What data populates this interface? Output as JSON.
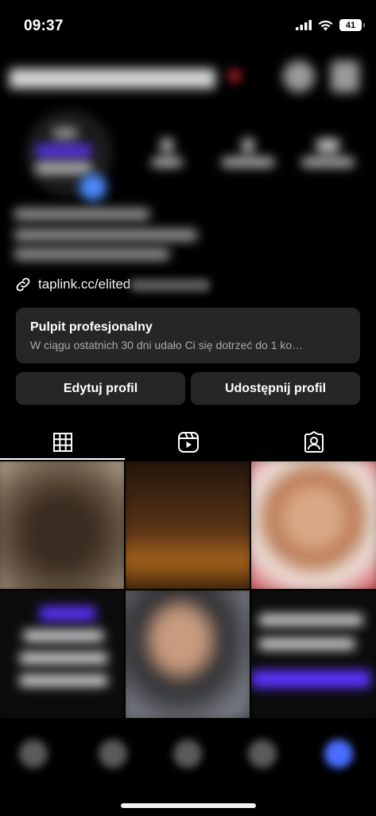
{
  "status_bar": {
    "time": "09:37",
    "battery": "41",
    "icons": [
      "signal-icon",
      "wifi-icon",
      "battery-icon"
    ]
  },
  "profile": {
    "link_text": "taplink.cc/elited",
    "dashboard": {
      "title": "Pulpit profesjonalny",
      "subtitle": "W ciągu ostatnich 30 dni udało Ci się dotrzeć do 1 ko…"
    },
    "edit_button": "Edytuj profil",
    "share_button": "Udostępnij profil"
  },
  "tabs": [
    {
      "name": "tab-posts-grid",
      "icon": "grid-icon",
      "active": true
    },
    {
      "name": "tab-reels",
      "icon": "reels-icon",
      "active": false
    },
    {
      "name": "tab-tagged",
      "icon": "tagged-person-icon",
      "active": false
    }
  ],
  "colors": {
    "background": "#000000",
    "card": "#262626",
    "secondary_text": "#a8a8a8",
    "accent_purple": "#5b34ff"
  }
}
